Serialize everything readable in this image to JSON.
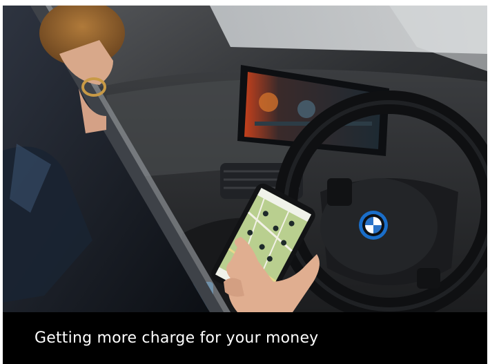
{
  "card": {
    "caption": "Getting more charge for your money"
  },
  "photo": {
    "subject": "person-holding-phone-with-charging-map-in-car",
    "colors": {
      "caption_background": "#000000",
      "caption_text": "#ffffff",
      "map_green": "#b9cf8f"
    }
  }
}
